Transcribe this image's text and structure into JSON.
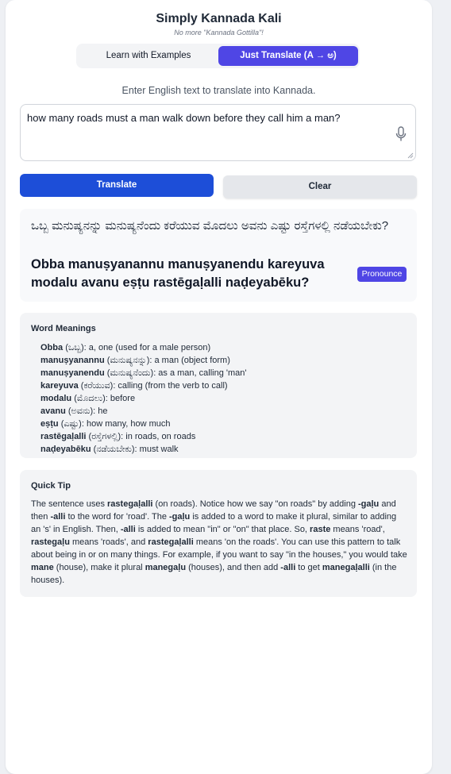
{
  "header": {
    "title": "Simply Kannada Kali",
    "subtitle": "No more \"Kannada Gottilla\"!"
  },
  "modes": {
    "examples_label": "Learn with Examples",
    "translate_label": "Just Translate (A → ಅ)",
    "active": "translate"
  },
  "instructions": "Enter English text to translate into Kannada.",
  "input": {
    "value": "how many roads must a man walk down before they call him a man?",
    "mic_icon": "microphone-icon"
  },
  "buttons": {
    "translate": "Translate",
    "clear": "Clear",
    "pronounce": "Pronounce"
  },
  "result": {
    "kannada": "ಒಬ್ಬ ಮನುಷ್ಯನನ್ನು ಮನುಷ್ಯನೆಂದು ಕರೆಯುವ ಮೊದಲು ಅವನು ಎಷ್ಟು ರಸ್ತೆಗಳಲ್ಲಿ ನಡೆಯಬೇಕು?",
    "romanized": "Obba manuṣyanannu manuṣyanendu kareyuva modalu avanu eṣṭu rastēgaḷalli naḍeyabēku?"
  },
  "meanings": {
    "heading": "Word Meanings",
    "items": [
      {
        "word": "Obba",
        "kn": "(ಒಬ್ಬ)",
        "meaning": ": a, one (used for a male person)"
      },
      {
        "word": "manuṣyanannu",
        "kn": "(ಮನುಷ್ಯನನ್ನು)",
        "meaning": ": a man (object form)"
      },
      {
        "word": "manuṣyanendu",
        "kn": "(ಮನುಷ್ಯನೆಂದು)",
        "meaning": ": as a man, calling 'man'"
      },
      {
        "word": "kareyuva",
        "kn": "(ಕರೆಯುವ)",
        "meaning": ": calling (from the verb to call)"
      },
      {
        "word": "modalu",
        "kn": "(ಮೊದಲು)",
        "meaning": ": before"
      },
      {
        "word": "avanu",
        "kn": "(ಅವನು)",
        "meaning": ": he"
      },
      {
        "word": "eṣṭu",
        "kn": "(ಎಷ್ಟು)",
        "meaning": ": how many, how much"
      },
      {
        "word": "rastēgaḷalli",
        "kn": "(ರಸ್ತೆಗಳಲ್ಲಿ)",
        "meaning": ": in roads, on roads"
      },
      {
        "word": "naḍeyabēku",
        "kn": "(ನಡೆಯಬೇಕು)",
        "meaning": ": must walk"
      }
    ]
  },
  "tip": {
    "heading": "Quick Tip",
    "segments": [
      {
        "t": "The sentence uses "
      },
      {
        "t": "rastegaḷalli",
        "b": true
      },
      {
        "t": " (on roads). Notice how we say \"on roads\" by adding "
      },
      {
        "t": "-gaḷu",
        "b": true
      },
      {
        "t": " and then "
      },
      {
        "t": "-alli",
        "b": true
      },
      {
        "t": " to the word for 'road'. The "
      },
      {
        "t": "-gaḷu",
        "b": true
      },
      {
        "t": " is added to a word to make it plural, similar to adding an 's' in English. Then, "
      },
      {
        "t": "-alli",
        "b": true
      },
      {
        "t": " is added to mean \"in\" or \"on\" that place. So, "
      },
      {
        "t": "raste",
        "b": true
      },
      {
        "t": " means 'road', "
      },
      {
        "t": "rastegaḷu",
        "b": true
      },
      {
        "t": " means 'roads', and "
      },
      {
        "t": "rastegaḷalli",
        "b": true
      },
      {
        "t": " means 'on the roads'. You can use this pattern to talk about being in or on many things. For example, if you want to say \"in the houses,\" you would take "
      },
      {
        "t": "mane",
        "b": true
      },
      {
        "t": " (house), make it plural "
      },
      {
        "t": "manegaḷu",
        "b": true
      },
      {
        "t": " (houses), and then add "
      },
      {
        "t": "-alli",
        "b": true
      },
      {
        "t": " to get "
      },
      {
        "t": "manegaḷalli",
        "b": true
      },
      {
        "t": " (in the houses)."
      }
    ]
  }
}
